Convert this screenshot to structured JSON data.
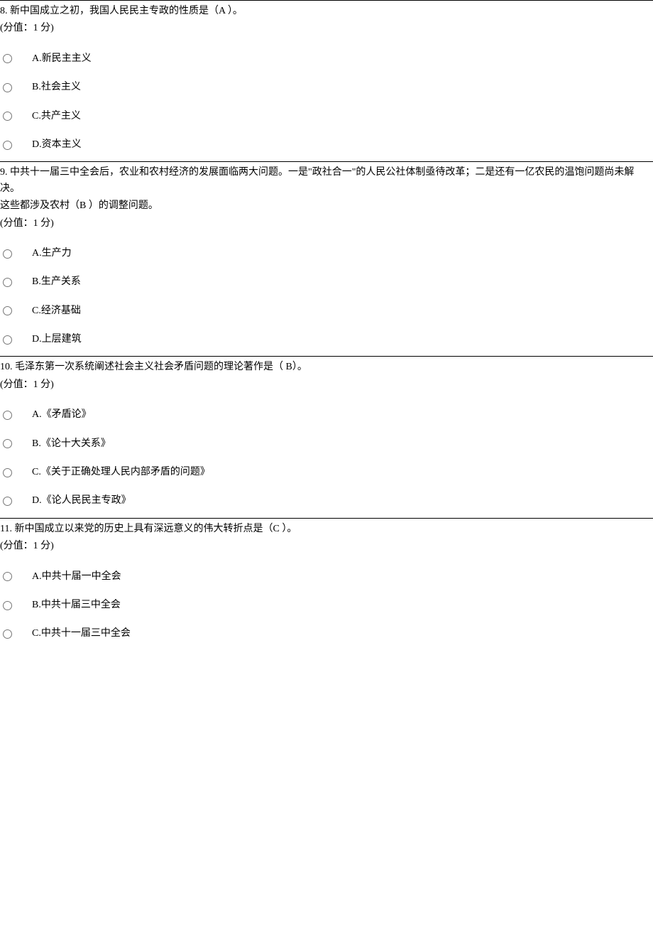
{
  "questions": [
    {
      "number": "8.",
      "text": "新中国成立之初，我国人民民主专政的性质是（A ）。",
      "score": "(分值：1 分)",
      "options": [
        "A.新民主主义",
        "B.社会主义",
        "C.共产主义",
        "D.资本主义"
      ]
    },
    {
      "number": "9.",
      "text": "中共十一届三中全会后，农业和农村经济的发展面临两大问题。一是\"政社合一\"的人民公社体制亟待改革；二是还有一亿农民的温饱问题尚未解决。",
      "text2": "这些都涉及农村（B ）的调整问题。",
      "score": "(分值：1 分)",
      "options": [
        "A.生产力",
        "B.生产关系",
        "C.经济基础",
        "D.上层建筑"
      ]
    },
    {
      "number": "10.",
      "text": "毛泽东第一次系统阐述社会主义社会矛盾问题的理论著作是（ B）。",
      "score": "(分值：1 分)",
      "options": [
        "A.《矛盾论》",
        "B.《论十大关系》",
        "C.《关于正确处理人民内部矛盾的问题》",
        "D.《论人民民主专政》"
      ]
    },
    {
      "number": "11.",
      "text": "新中国成立以来党的历史上具有深远意义的伟大转折点是（C ）。",
      "score": "(分值：1 分)",
      "options": [
        "A.中共十届一中全会",
        "B.中共十届三中全会",
        "C.中共十一届三中全会"
      ]
    }
  ]
}
